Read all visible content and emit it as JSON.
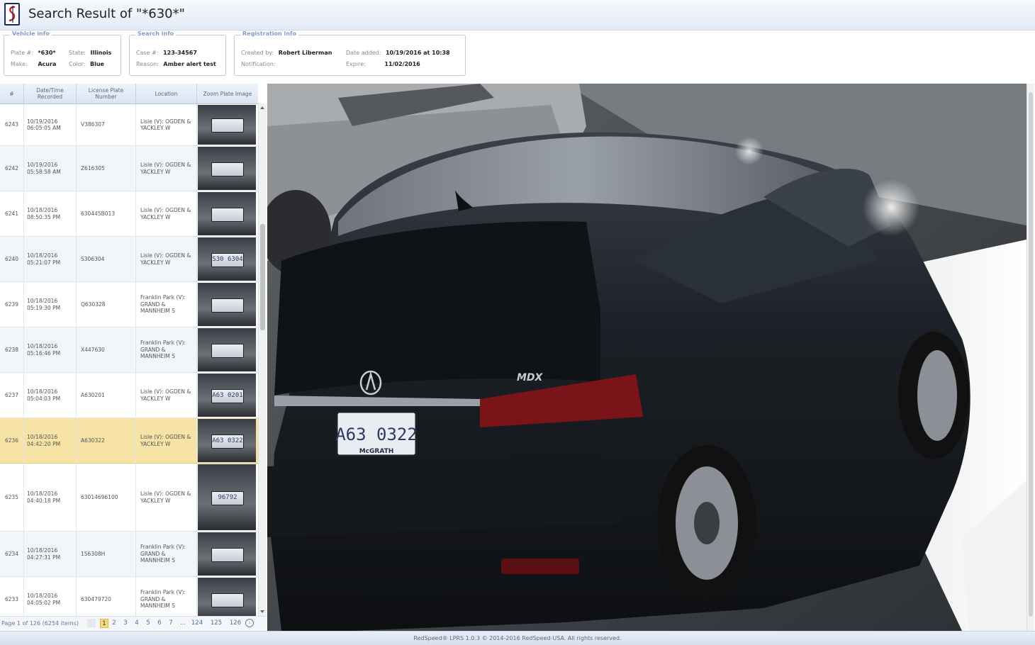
{
  "header": {
    "title_prefix": "Search Result of ",
    "title_query": "\"*630*\""
  },
  "vehicle_info": {
    "legend": "Vehicle info",
    "plate_label": "Plate #:",
    "plate_value": "*630*",
    "state_label": "State:",
    "state_value": "Illinois",
    "make_label": "Make:",
    "make_value": "Acura",
    "color_label": "Color:",
    "color_value": "Blue"
  },
  "search_info": {
    "legend": "Search info",
    "case_label": "Case #:",
    "case_value": "123-34567",
    "reason_label": "Reason:",
    "reason_value": "Amber alert test"
  },
  "registration_info": {
    "legend": "Registration info",
    "created_label": "Created by:",
    "created_value": "Robert Liberman",
    "date_added_label": "Date added:",
    "date_added_value": "10/19/2016 at 10:38",
    "notification_label": "Notification:",
    "notification_value": "",
    "expire_label": "Expire:",
    "expire_value": "11/02/2016"
  },
  "table": {
    "headers": [
      "#",
      "Date/Time Recorded",
      "License Plate Number",
      "Location",
      "Zoom Plate Image"
    ],
    "rows": [
      {
        "num": "6243",
        "date": "10/19/2016",
        "time": "06:05:05 AM",
        "plate": "V386307",
        "loc": "Lisle (V): OGDEN & YACKLEY W",
        "thumb": ""
      },
      {
        "num": "6242",
        "date": "10/19/2016",
        "time": "05:58:58 AM",
        "plate": "Z616305",
        "loc": "Lisle (V): OGDEN & YACKLEY W",
        "thumb": ""
      },
      {
        "num": "6241",
        "date": "10/18/2016",
        "time": "08:50:35 PM",
        "plate": "630445B013",
        "loc": "Lisle (V): OGDEN & YACKLEY W",
        "thumb": ""
      },
      {
        "num": "6240",
        "date": "10/18/2016",
        "time": "05:21:07 PM",
        "plate": "S306304",
        "loc": "Lisle (V): OGDEN & YACKLEY W",
        "thumb": "S30 6304"
      },
      {
        "num": "6239",
        "date": "10/18/2016",
        "time": "05:19:30 PM",
        "plate": "Q630328",
        "loc": "Franklin Park (V): GRAND & MANNHEIM S",
        "thumb": ""
      },
      {
        "num": "6238",
        "date": "10/18/2016",
        "time": "05:16:46 PM",
        "plate": "X447630",
        "loc": "Franklin Park (V): GRAND & MANNHEIM S",
        "thumb": ""
      },
      {
        "num": "6237",
        "date": "10/18/2016",
        "time": "05:04:03 PM",
        "plate": "A630201",
        "loc": "Lisle (V): OGDEN & YACKLEY W",
        "thumb": "A63 0201"
      },
      {
        "num": "6236",
        "date": "10/18/2016",
        "time": "04:42:20 PM",
        "plate": "A630322",
        "loc": "Lisle (V): OGDEN & YACKLEY W",
        "thumb": "A63 0322"
      },
      {
        "num": "6235",
        "date": "10/18/2016",
        "time": "04:40:18 PM",
        "plate": "63014696100",
        "loc": "Lisle (V): OGDEN & YACKLEY W",
        "thumb": "96792"
      },
      {
        "num": "6234",
        "date": "10/18/2016",
        "time": "04:27:31 PM",
        "plate": "156308H",
        "loc": "Franklin Park (V): GRAND & MANNHEIM S",
        "thumb": ""
      },
      {
        "num": "6233",
        "date": "10/18/2016",
        "time": "04:05:02 PM",
        "plate": "630479720",
        "loc": "Franklin Park (V): GRAND & MANNHEIM S",
        "thumb": ""
      }
    ]
  },
  "pager": {
    "info": "Page 1 of 126 (6254 items)",
    "pages": [
      "1",
      "2",
      "3",
      "4",
      "5",
      "6",
      "7",
      "...",
      "124",
      "125",
      "126"
    ],
    "current": "1"
  },
  "photo": {
    "badge": "MDX",
    "plate_text": "A63 0322",
    "plate_dealer": "McGRATH"
  },
  "footer": {
    "text": "RedSpeed® LPRS 1.0.3 © 2014-2016 RedSpeed-USA. All rights reserved."
  },
  "colors": {
    "selected_row": "#f8e3a6",
    "header_bg": "#e2ebf6",
    "legend": "#7f9fc9"
  },
  "icons": [
    "logo-icon",
    "prev-page-icon",
    "next-page-icon"
  ]
}
